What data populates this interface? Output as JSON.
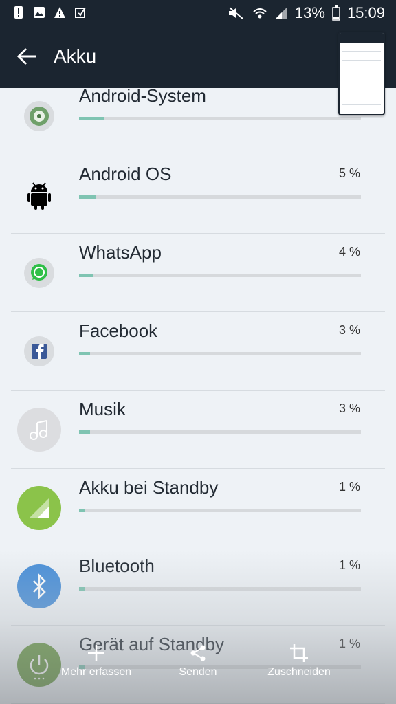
{
  "status_bar": {
    "battery_percent": "13%",
    "time": "15:09",
    "icons": [
      "alert-icon",
      "image-icon",
      "warning-icon",
      "nfc-icon",
      "mute-icon",
      "wifi-icon",
      "signal-icon",
      "battery-icon"
    ]
  },
  "app_bar": {
    "title": "Akku"
  },
  "apps": [
    {
      "name": "Android-System",
      "percent": "",
      "usage": 0.09,
      "icon": "android-system-icon"
    },
    {
      "name": "Android OS",
      "percent": "5 %",
      "usage": 0.06,
      "icon": "android-robot-icon"
    },
    {
      "name": "WhatsApp",
      "percent": "4 %",
      "usage": 0.05,
      "icon": "whatsapp-icon"
    },
    {
      "name": "Facebook",
      "percent": "3 %",
      "usage": 0.04,
      "icon": "facebook-icon"
    },
    {
      "name": "Musik",
      "percent": "3 %",
      "usage": 0.04,
      "icon": "music-icon"
    },
    {
      "name": "Akku bei Standby",
      "percent": "1 %",
      "usage": 0.02,
      "icon": "standby-signal-icon"
    },
    {
      "name": "Bluetooth",
      "percent": "1 %",
      "usage": 0.02,
      "icon": "bluetooth-icon"
    },
    {
      "name": "Gerät auf Standby",
      "percent": "1 %",
      "usage": 0.02,
      "icon": "power-icon"
    }
  ],
  "screenshot_actions": [
    {
      "label": "Mehr erfassen",
      "icon": "plus-icon"
    },
    {
      "label": "Senden",
      "icon": "share-icon"
    },
    {
      "label": "Zuschneiden",
      "icon": "crop-icon"
    }
  ],
  "colors": {
    "header": "#1b2530",
    "background": "#eef2f6",
    "bar_fill": "#7fc4b2",
    "bar_track": "#d6d9dc",
    "standby_green": "#8bc34a",
    "bluetooth_blue": "#4a90d9"
  }
}
